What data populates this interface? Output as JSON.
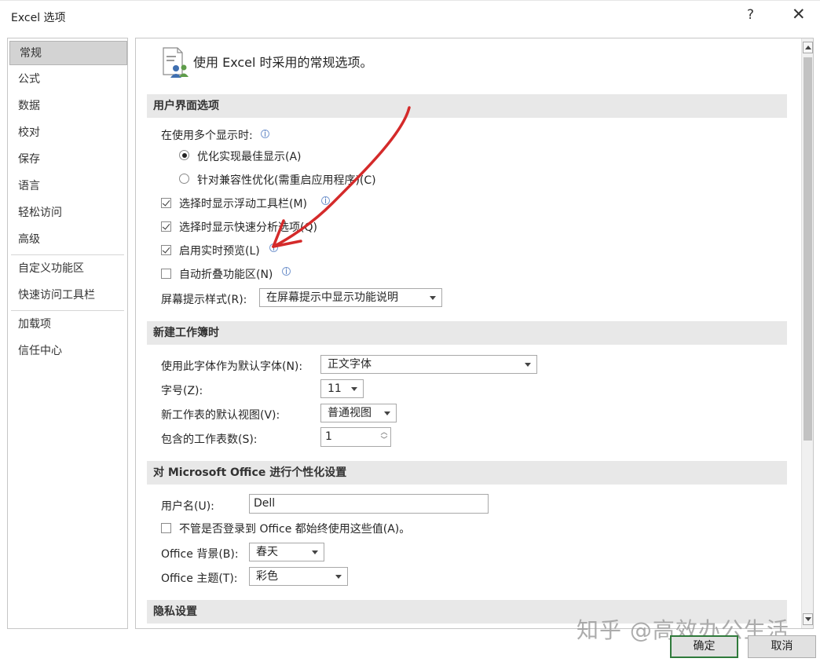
{
  "window": {
    "title": "Excel 选项",
    "help": "?",
    "close": "✕"
  },
  "nav": {
    "items": [
      "常规",
      "公式",
      "数据",
      "校对",
      "保存",
      "语言",
      "轻松访问",
      "高级",
      "自定义功能区",
      "快速访问工具栏",
      "加载项",
      "信任中心"
    ],
    "selected": "常规"
  },
  "header": {
    "text": "使用 Excel 时采用的常规选项。"
  },
  "sections": {
    "ui": "用户界面选项",
    "new_workbook": "新建工作簿时",
    "personalize": "对 Microsoft Office 进行个性化设置",
    "privacy": "隐私设置"
  },
  "ui_options": {
    "multi_display_label": "在使用多个显示时:",
    "radio_optimize_appearance": "优化实现最佳显示(A)",
    "radio_optimize_compat": "针对兼容性优化(需重启应用程序)(C)",
    "cb_mini_toolbar": "选择时显示浮动工具栏(M)",
    "cb_quick_analysis": "选择时显示快速分析选项(Q)",
    "cb_live_preview": "启用实时预览(L)",
    "cb_collapse_ribbon": "自动折叠功能区(N)",
    "screentip_label": "屏幕提示样式(R):",
    "screentip_value": "在屏幕提示中显示功能说明"
  },
  "new_workbook": {
    "font_label": "使用此字体作为默认字体(N):",
    "font_value": "正文字体",
    "size_label": "字号(Z):",
    "size_value": "11",
    "view_label": "新工作表的默认视图(V):",
    "view_value": "普通视图",
    "sheets_label": "包含的工作表数(S):",
    "sheets_value": "1"
  },
  "personalize": {
    "username_label": "用户名(U):",
    "username_value": "Dell",
    "cb_always_use": "不管是否登录到 Office 都始终使用这些值(A)。",
    "background_label": "Office 背景(B):",
    "background_value": "春天",
    "theme_label": "Office 主题(T):",
    "theme_value": "彩色"
  },
  "buttons": {
    "ok": "确定",
    "cancel": "取消"
  },
  "watermark": "知乎 @高效办公生活",
  "colors": {
    "annotation_arrow": "#d42a2a",
    "ok_border": "#2f7a3b",
    "section_bg": "#e8e8e8",
    "nav_selected_bg": "#d3d3d3"
  }
}
